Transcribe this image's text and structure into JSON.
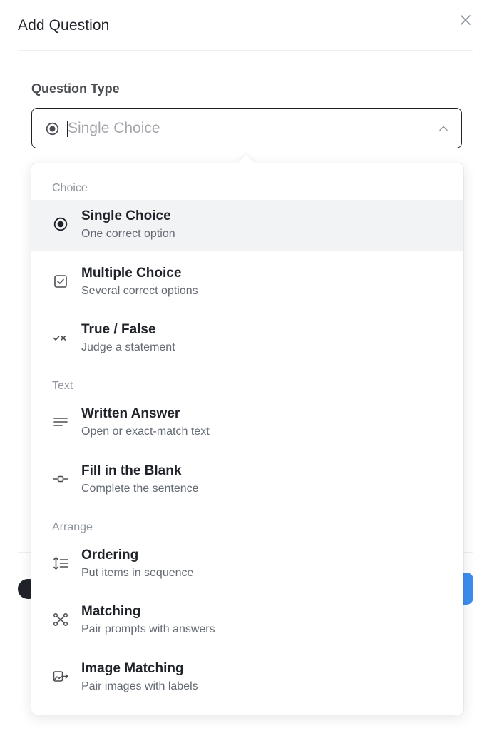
{
  "modal": {
    "title": "Add Question",
    "close_icon": "close-icon"
  },
  "question_type": {
    "label": "Question Type",
    "select": {
      "placeholder": "Single Choice",
      "value": "",
      "icon": "radio-icon",
      "chevron_icon": "chevron-up-icon"
    }
  },
  "dropdown": {
    "groups": [
      {
        "label": "Choice",
        "options": [
          {
            "title": "Single Choice",
            "desc": "One correct option",
            "icon": "radio-icon",
            "selected": true
          },
          {
            "title": "Multiple Choice",
            "desc": "Several correct options",
            "icon": "checkbox-icon",
            "selected": false
          },
          {
            "title": "True / False",
            "desc": "Judge a statement",
            "icon": "check-cross-icon",
            "selected": false
          }
        ]
      },
      {
        "label": "Text",
        "options": [
          {
            "title": "Written Answer",
            "desc": "Open or exact-match text",
            "icon": "text-lines-icon",
            "selected": false
          },
          {
            "title": "Fill in the Blank",
            "desc": "Complete the sentence",
            "icon": "blank-slot-icon",
            "selected": false
          }
        ]
      },
      {
        "label": "Arrange",
        "options": [
          {
            "title": "Ordering",
            "desc": "Put items in sequence",
            "icon": "ordering-icon",
            "selected": false
          },
          {
            "title": "Matching",
            "desc": "Pair prompts with answers",
            "icon": "matching-icon",
            "selected": false
          },
          {
            "title": "Image Matching",
            "desc": "Pair images with labels",
            "icon": "image-matching-icon",
            "selected": false
          }
        ]
      }
    ]
  },
  "colors": {
    "text_primary": "#1f2329",
    "text_secondary": "#646a73",
    "group_label": "#8f959e",
    "selected_bg": "#f2f3f5",
    "primary_button": "#3d8ef0"
  }
}
